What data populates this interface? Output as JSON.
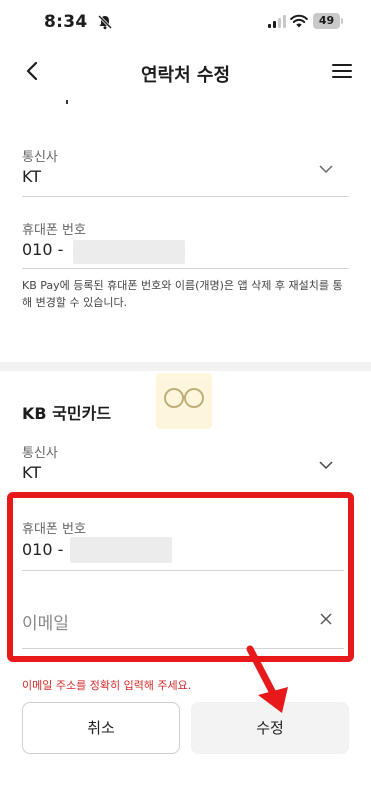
{
  "status_bar": {
    "time": "8:34",
    "battery": "49"
  },
  "nav": {
    "title": "연락처 수정"
  },
  "section1": {
    "carrier_label": "통신사",
    "carrier_value": "KT",
    "phone_label": "휴대폰 번호",
    "phone_prefix": "010 -",
    "notice": "KB Pay에 등록된 휴대폰 번호와 이름(개명)은 앱 삭제 후 재설치를 통해 변경할 수 있습니다."
  },
  "section2": {
    "title": "KB 국민카드",
    "carrier_label": "통신사",
    "carrier_value": "KT",
    "phone_label": "휴대폰 번호",
    "phone_prefix": "010 -",
    "email_placeholder": "이메일",
    "error": "이메일 주소를 정확히 입력해 주세요."
  },
  "buttons": {
    "cancel": "취소",
    "save": "수정"
  },
  "colors": {
    "highlight": "#e8191b",
    "error": "#d42b2b"
  }
}
